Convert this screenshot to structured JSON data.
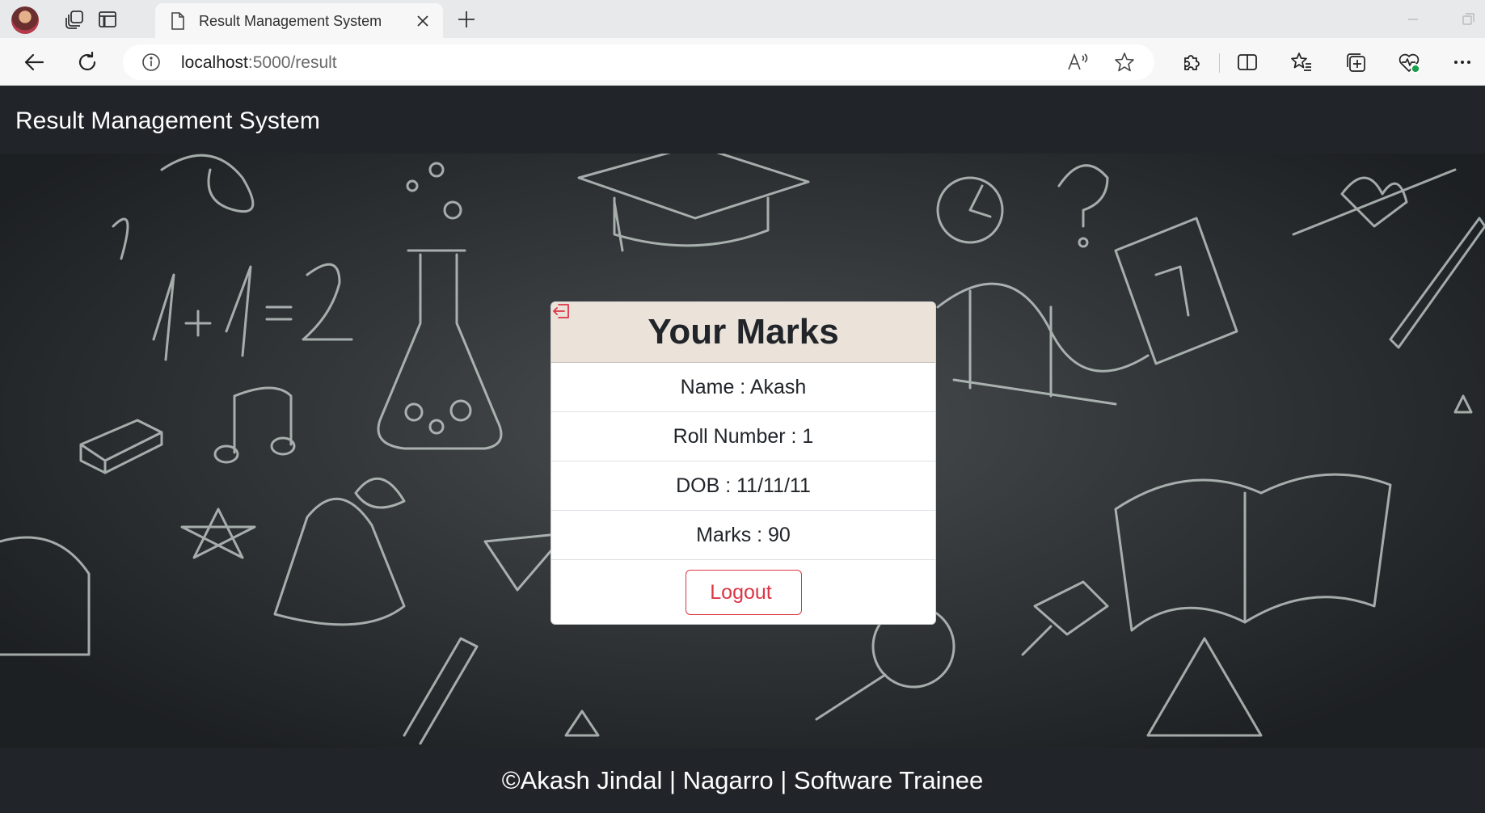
{
  "browser": {
    "tab_title": "Result Management System",
    "url_host": "localhost",
    "url_rest": ":5000/result"
  },
  "navbar": {
    "brand": "Result Management System"
  },
  "card": {
    "title": "Your Marks",
    "name": "Name : Akash",
    "roll": "Roll Number : 1",
    "dob": "DOB : 11/11/11",
    "marks": "Marks : 90",
    "logout_label": "Logout"
  },
  "footer": {
    "text": "©Akash Jindal | Nagarro | Software Trainee"
  },
  "colors": {
    "navbar_bg": "#212529",
    "card_header_bg": "#ebe3da",
    "logout_accent": "#dc3545"
  },
  "icons": [
    "profile-avatar",
    "workspaces-icon",
    "tab-actions-icon",
    "page-icon",
    "close-icon",
    "plus-icon",
    "minimize-icon",
    "restore-icon",
    "back-icon",
    "refresh-icon",
    "info-icon",
    "read-aloud-icon",
    "favorite-star-icon",
    "extensions-icon",
    "split-screen-icon",
    "favorites-icon",
    "collections-icon",
    "browser-essentials-icon",
    "more-icon",
    "logout-icon"
  ]
}
